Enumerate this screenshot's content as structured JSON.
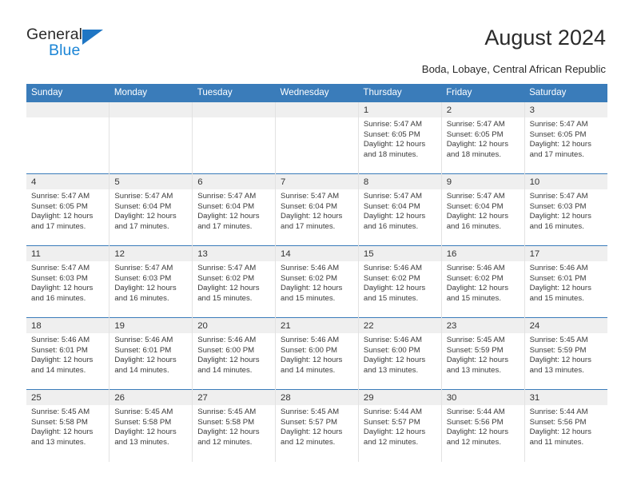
{
  "brand": {
    "name_top": "General",
    "name_bottom": "Blue",
    "triangle_icon": "brand-triangle-icon",
    "accent_color": "#1f76c4",
    "blue_text_color": "#1b85d6"
  },
  "header": {
    "title": "August 2024",
    "subtitle": "Boda, Lobaye, Central African Republic"
  },
  "colors": {
    "header_row_blue": "#3a7cba",
    "day_band_gray": "#efefef",
    "cell_border": "#e2e2e2",
    "text": "#3a3a3a"
  },
  "calendar": {
    "weekday_headers": [
      "Sunday",
      "Monday",
      "Tuesday",
      "Wednesday",
      "Thursday",
      "Friday",
      "Saturday"
    ],
    "labels": {
      "sunrise": "Sunrise:",
      "sunset": "Sunset:",
      "daylight": "Daylight:"
    },
    "weeks": [
      [
        {
          "day": "",
          "empty": true
        },
        {
          "day": "",
          "empty": true
        },
        {
          "day": "",
          "empty": true
        },
        {
          "day": "",
          "empty": true
        },
        {
          "day": "1",
          "sunrise": "Sunrise: 5:47 AM",
          "sunset": "Sunset: 6:05 PM",
          "daylight_l1": "Daylight: 12 hours",
          "daylight_l2": "and 18 minutes."
        },
        {
          "day": "2",
          "sunrise": "Sunrise: 5:47 AM",
          "sunset": "Sunset: 6:05 PM",
          "daylight_l1": "Daylight: 12 hours",
          "daylight_l2": "and 18 minutes."
        },
        {
          "day": "3",
          "sunrise": "Sunrise: 5:47 AM",
          "sunset": "Sunset: 6:05 PM",
          "daylight_l1": "Daylight: 12 hours",
          "daylight_l2": "and 17 minutes."
        }
      ],
      [
        {
          "day": "4",
          "sunrise": "Sunrise: 5:47 AM",
          "sunset": "Sunset: 6:05 PM",
          "daylight_l1": "Daylight: 12 hours",
          "daylight_l2": "and 17 minutes."
        },
        {
          "day": "5",
          "sunrise": "Sunrise: 5:47 AM",
          "sunset": "Sunset: 6:04 PM",
          "daylight_l1": "Daylight: 12 hours",
          "daylight_l2": "and 17 minutes."
        },
        {
          "day": "6",
          "sunrise": "Sunrise: 5:47 AM",
          "sunset": "Sunset: 6:04 PM",
          "daylight_l1": "Daylight: 12 hours",
          "daylight_l2": "and 17 minutes."
        },
        {
          "day": "7",
          "sunrise": "Sunrise: 5:47 AM",
          "sunset": "Sunset: 6:04 PM",
          "daylight_l1": "Daylight: 12 hours",
          "daylight_l2": "and 17 minutes."
        },
        {
          "day": "8",
          "sunrise": "Sunrise: 5:47 AM",
          "sunset": "Sunset: 6:04 PM",
          "daylight_l1": "Daylight: 12 hours",
          "daylight_l2": "and 16 minutes."
        },
        {
          "day": "9",
          "sunrise": "Sunrise: 5:47 AM",
          "sunset": "Sunset: 6:04 PM",
          "daylight_l1": "Daylight: 12 hours",
          "daylight_l2": "and 16 minutes."
        },
        {
          "day": "10",
          "sunrise": "Sunrise: 5:47 AM",
          "sunset": "Sunset: 6:03 PM",
          "daylight_l1": "Daylight: 12 hours",
          "daylight_l2": "and 16 minutes."
        }
      ],
      [
        {
          "day": "11",
          "sunrise": "Sunrise: 5:47 AM",
          "sunset": "Sunset: 6:03 PM",
          "daylight_l1": "Daylight: 12 hours",
          "daylight_l2": "and 16 minutes."
        },
        {
          "day": "12",
          "sunrise": "Sunrise: 5:47 AM",
          "sunset": "Sunset: 6:03 PM",
          "daylight_l1": "Daylight: 12 hours",
          "daylight_l2": "and 16 minutes."
        },
        {
          "day": "13",
          "sunrise": "Sunrise: 5:47 AM",
          "sunset": "Sunset: 6:02 PM",
          "daylight_l1": "Daylight: 12 hours",
          "daylight_l2": "and 15 minutes."
        },
        {
          "day": "14",
          "sunrise": "Sunrise: 5:46 AM",
          "sunset": "Sunset: 6:02 PM",
          "daylight_l1": "Daylight: 12 hours",
          "daylight_l2": "and 15 minutes."
        },
        {
          "day": "15",
          "sunrise": "Sunrise: 5:46 AM",
          "sunset": "Sunset: 6:02 PM",
          "daylight_l1": "Daylight: 12 hours",
          "daylight_l2": "and 15 minutes."
        },
        {
          "day": "16",
          "sunrise": "Sunrise: 5:46 AM",
          "sunset": "Sunset: 6:02 PM",
          "daylight_l1": "Daylight: 12 hours",
          "daylight_l2": "and 15 minutes."
        },
        {
          "day": "17",
          "sunrise": "Sunrise: 5:46 AM",
          "sunset": "Sunset: 6:01 PM",
          "daylight_l1": "Daylight: 12 hours",
          "daylight_l2": "and 15 minutes."
        }
      ],
      [
        {
          "day": "18",
          "sunrise": "Sunrise: 5:46 AM",
          "sunset": "Sunset: 6:01 PM",
          "daylight_l1": "Daylight: 12 hours",
          "daylight_l2": "and 14 minutes."
        },
        {
          "day": "19",
          "sunrise": "Sunrise: 5:46 AM",
          "sunset": "Sunset: 6:01 PM",
          "daylight_l1": "Daylight: 12 hours",
          "daylight_l2": "and 14 minutes."
        },
        {
          "day": "20",
          "sunrise": "Sunrise: 5:46 AM",
          "sunset": "Sunset: 6:00 PM",
          "daylight_l1": "Daylight: 12 hours",
          "daylight_l2": "and 14 minutes."
        },
        {
          "day": "21",
          "sunrise": "Sunrise: 5:46 AM",
          "sunset": "Sunset: 6:00 PM",
          "daylight_l1": "Daylight: 12 hours",
          "daylight_l2": "and 14 minutes."
        },
        {
          "day": "22",
          "sunrise": "Sunrise: 5:46 AM",
          "sunset": "Sunset: 6:00 PM",
          "daylight_l1": "Daylight: 12 hours",
          "daylight_l2": "and 13 minutes."
        },
        {
          "day": "23",
          "sunrise": "Sunrise: 5:45 AM",
          "sunset": "Sunset: 5:59 PM",
          "daylight_l1": "Daylight: 12 hours",
          "daylight_l2": "and 13 minutes."
        },
        {
          "day": "24",
          "sunrise": "Sunrise: 5:45 AM",
          "sunset": "Sunset: 5:59 PM",
          "daylight_l1": "Daylight: 12 hours",
          "daylight_l2": "and 13 minutes."
        }
      ],
      [
        {
          "day": "25",
          "sunrise": "Sunrise: 5:45 AM",
          "sunset": "Sunset: 5:58 PM",
          "daylight_l1": "Daylight: 12 hours",
          "daylight_l2": "and 13 minutes."
        },
        {
          "day": "26",
          "sunrise": "Sunrise: 5:45 AM",
          "sunset": "Sunset: 5:58 PM",
          "daylight_l1": "Daylight: 12 hours",
          "daylight_l2": "and 13 minutes."
        },
        {
          "day": "27",
          "sunrise": "Sunrise: 5:45 AM",
          "sunset": "Sunset: 5:58 PM",
          "daylight_l1": "Daylight: 12 hours",
          "daylight_l2": "and 12 minutes."
        },
        {
          "day": "28",
          "sunrise": "Sunrise: 5:45 AM",
          "sunset": "Sunset: 5:57 PM",
          "daylight_l1": "Daylight: 12 hours",
          "daylight_l2": "and 12 minutes."
        },
        {
          "day": "29",
          "sunrise": "Sunrise: 5:44 AM",
          "sunset": "Sunset: 5:57 PM",
          "daylight_l1": "Daylight: 12 hours",
          "daylight_l2": "and 12 minutes."
        },
        {
          "day": "30",
          "sunrise": "Sunrise: 5:44 AM",
          "sunset": "Sunset: 5:56 PM",
          "daylight_l1": "Daylight: 12 hours",
          "daylight_l2": "and 12 minutes."
        },
        {
          "day": "31",
          "sunrise": "Sunrise: 5:44 AM",
          "sunset": "Sunset: 5:56 PM",
          "daylight_l1": "Daylight: 12 hours",
          "daylight_l2": "and 11 minutes."
        }
      ]
    ]
  }
}
